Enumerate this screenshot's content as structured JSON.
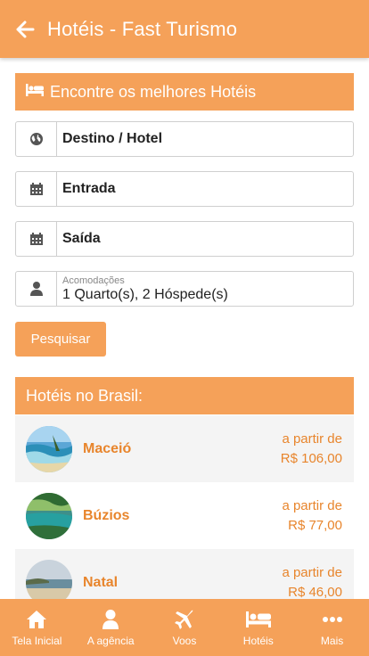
{
  "header": {
    "title": "Hotéis - Fast Turismo"
  },
  "search": {
    "heading": "Encontre os melhores Hotéis",
    "destination": "Destino / Hotel",
    "checkin": "Entrada",
    "checkout": "Saída",
    "accommodations_label": "Acomodações",
    "accommodations_value": "1 Quarto(s), 2 Hóspede(s)",
    "button": "Pesquisar"
  },
  "hotels": {
    "heading": "Hotéis no Brasil:",
    "items": [
      {
        "city": "Maceió",
        "from": "a partir de",
        "price": "R$ 106,00"
      },
      {
        "city": "Búzios",
        "from": "a partir de",
        "price": "R$ 77,00"
      },
      {
        "city": "Natal",
        "from": "a partir de",
        "price": "R$ 46,00"
      }
    ]
  },
  "nav": {
    "items": [
      {
        "label": "Tela Inicial",
        "icon": "home-icon"
      },
      {
        "label": "A agência",
        "icon": "user-icon"
      },
      {
        "label": "Voos",
        "icon": "plane-icon"
      },
      {
        "label": "Hotéis",
        "icon": "bed-icon"
      },
      {
        "label": "Mais",
        "icon": "more-icon"
      }
    ]
  },
  "colors": {
    "accent": "#f5a159",
    "price": "#e8852c"
  }
}
